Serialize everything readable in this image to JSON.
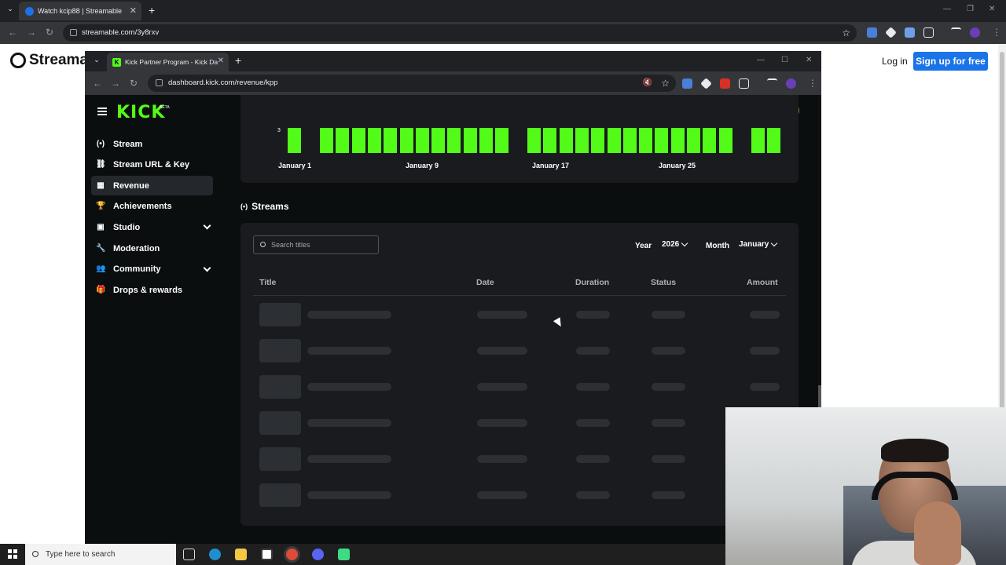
{
  "outer_browser": {
    "tab_title": "Watch kcip88 | Streamable",
    "url": "streamable.com/3y8rxv"
  },
  "streamable": {
    "logo_text": "Streamab",
    "login_label": "Log in",
    "signup_label": "Sign up for free"
  },
  "inner_browser": {
    "tab_title": "Kick Partner Program - Kick Da",
    "url": "dashboard.kick.com/revenue/kpp"
  },
  "kick": {
    "logo": "KICK",
    "beta": "BETA",
    "sidebar": {
      "items": [
        {
          "label": "Stream",
          "icon": "broadcast-icon",
          "active": false,
          "expandable": false
        },
        {
          "label": "Stream URL & Key",
          "icon": "link-icon",
          "active": false,
          "expandable": false
        },
        {
          "label": "Revenue",
          "icon": "chart-icon",
          "active": true,
          "expandable": false
        },
        {
          "label": "Achievements",
          "icon": "trophy-icon",
          "active": false,
          "expandable": false
        },
        {
          "label": "Studio",
          "icon": "studio-icon",
          "active": false,
          "expandable": true
        },
        {
          "label": "Moderation",
          "icon": "wrench-icon",
          "active": false,
          "expandable": false
        },
        {
          "label": "Community",
          "icon": "people-icon",
          "active": false,
          "expandable": true
        },
        {
          "label": "Drops & rewards",
          "icon": "gift-icon",
          "active": false,
          "expandable": false
        }
      ]
    },
    "chart": {
      "y_tick": "3",
      "x_labels": [
        "January 1",
        "January 9",
        "January 17",
        "January 25"
      ],
      "bar_color": "#53fc18"
    },
    "streams": {
      "heading": "Streams",
      "search_placeholder": "Search titles",
      "year_label": "Year",
      "year_value": "2026",
      "month_label": "Month",
      "month_value": "January",
      "columns": [
        "Title",
        "Date",
        "Duration",
        "Status",
        "Amount"
      ],
      "loading_rows": 6
    }
  },
  "taskbar": {
    "search_placeholder": "Type here to search"
  },
  "colors": {
    "kick_green": "#53fc18",
    "streamable_blue": "#1a73e8"
  }
}
